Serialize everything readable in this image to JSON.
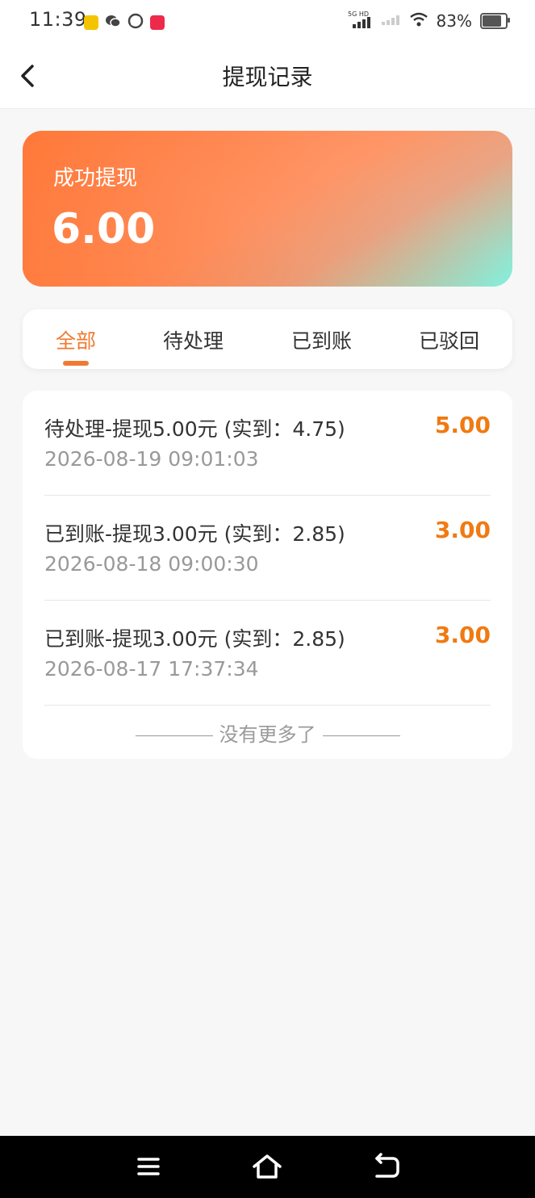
{
  "status_bar": {
    "time": "11:39",
    "network": "5G HD",
    "battery": "83%",
    "battery_level": 0.83
  },
  "header": {
    "title": "提现记录",
    "back_icon": "chevron-left-icon"
  },
  "summary": {
    "label": "成功提现",
    "amount": "6.00"
  },
  "tabs": [
    {
      "label": "全部",
      "active": true
    },
    {
      "label": "待处理",
      "active": false
    },
    {
      "label": "已到账",
      "active": false
    },
    {
      "label": "已驳回",
      "active": false
    }
  ],
  "records": [
    {
      "title": "待处理-提现5.00元 (实到：4.75)",
      "time": "2026-08-19 09:01:03",
      "amount": "5.00"
    },
    {
      "title": "已到账-提现3.00元 (实到：2.85)",
      "time": "2026-08-18 09:00:30",
      "amount": "3.00"
    },
    {
      "title": "已到账-提现3.00元 (实到：2.85)",
      "time": "2026-08-17 17:37:34",
      "amount": "3.00"
    }
  ],
  "footer_text": "没有更多了",
  "colors": {
    "accent": "#f07a32",
    "amount": "#f07a12"
  },
  "system_nav": {
    "menu_icon": "menu-icon",
    "home_icon": "home-icon",
    "back_icon": "back-arrow-icon"
  }
}
